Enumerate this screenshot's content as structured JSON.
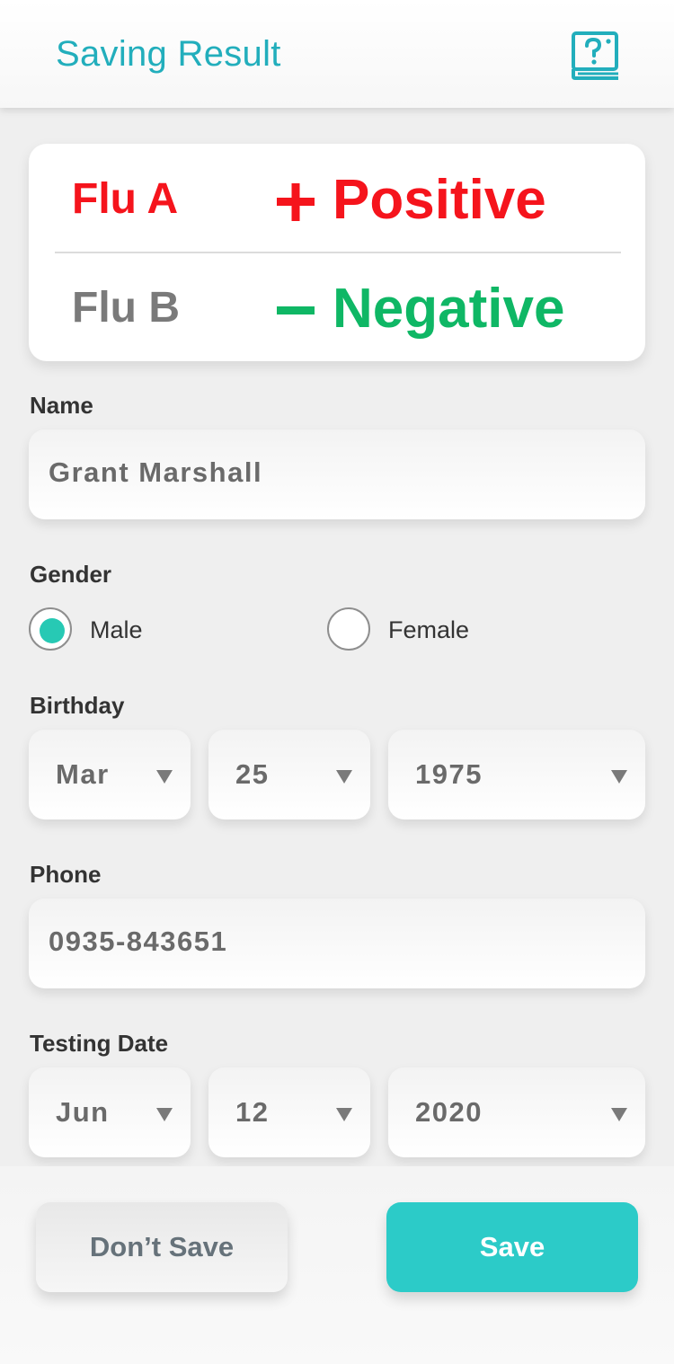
{
  "header": {
    "title": "Saving Result",
    "help_icon": "book-question-icon"
  },
  "colors": {
    "accent": "#22aebc",
    "positive": "#f5141c",
    "negative": "#0fb765",
    "radio_selected": "#27c9b4",
    "save_button": "#2ccbc8"
  },
  "results": {
    "flu_a": {
      "label": "Flu A",
      "sign": "+",
      "value": "Positive"
    },
    "flu_b": {
      "label": "Flu B",
      "sign": "−",
      "value": "Negative"
    }
  },
  "form": {
    "name": {
      "label": "Name",
      "value": "Grant Marshall"
    },
    "gender": {
      "label": "Gender",
      "options": [
        "Male",
        "Female"
      ],
      "selected": "Male"
    },
    "birthday": {
      "label": "Birthday",
      "month": "Mar",
      "day": "25",
      "year": "1975"
    },
    "phone": {
      "label": "Phone",
      "value": "0935-843651"
    },
    "testing_date": {
      "label": "Testing Date",
      "month": "Jun",
      "day": "12",
      "year": "2020"
    }
  },
  "footer": {
    "dont_save_label": "Don’t Save",
    "save_label": "Save"
  }
}
